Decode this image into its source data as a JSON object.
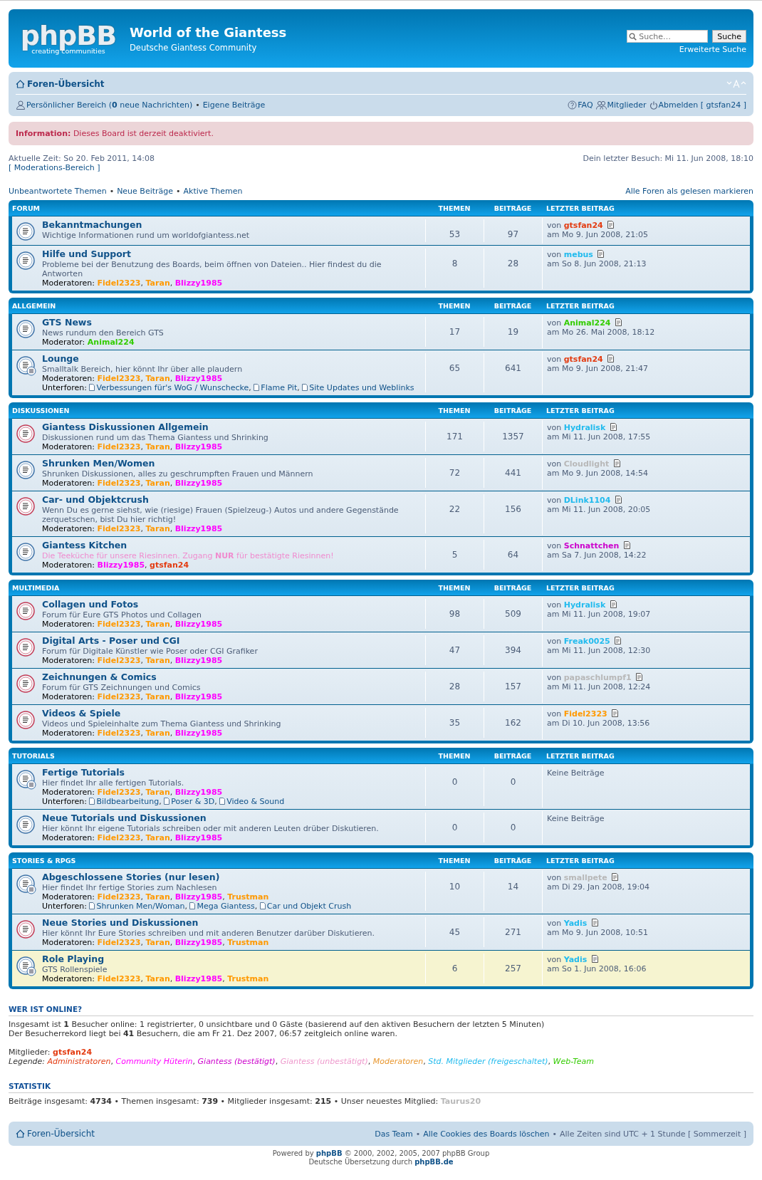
{
  "header": {
    "logo": "phpBB",
    "logo_tagline": "creating communities",
    "site_title": "World of the Giantess",
    "site_subtitle": "Deutsche Giantess Community",
    "search": {
      "placeholder": "Suche…",
      "button": "Suche",
      "advanced": "Erweiterte Suche"
    }
  },
  "navbar": {
    "home": "Foren-Übersicht",
    "pm": "Persönlicher Bereich (**0** neue Nachrichten)",
    "sep": "•",
    "own_posts": "Eigene Beiträge",
    "faq": "FAQ",
    "members": "Mitglieder",
    "logout": "Abmelden [ gtsfan24 ]"
  },
  "info": "**Information:** Dieses Board ist derzeit deaktiviert.",
  "current_time": "Aktuelle Zeit: So 20. Feb 2011, 14:08",
  "moderation_link": "[ Moderations-Bereich ]",
  "last_visit": "Dein letzter Besuch: Mi 11. Jun 2008, 18:10",
  "quick_links": [
    {
      "kind": "link",
      "text": "Unbeantwortete Themen"
    },
    {
      "kind": "sep",
      "text": "•"
    },
    {
      "kind": "link",
      "text": "Neue Beiträge"
    },
    {
      "kind": "sep",
      "text": "•"
    },
    {
      "kind": "link",
      "text": "Aktive Themen"
    }
  ],
  "mark_read": "Alle Foren als gelesen markieren",
  "list_separator": ",",
  "categories": [
    {
      "name": "FORUM",
      "columns": [
        "THEMEN",
        "BEITRÄGE",
        "LETZTER BEITRAG"
      ],
      "forums": [
        {
          "kind": "forum",
          "unread": false,
          "highlighted": false,
          "title": "Bekanntmachungen",
          "description": "Wichtige Informationen rund um worldofgiantess.net",
          "topics": "53",
          "posts": "97",
          "last_post": {
            "by": "von",
            "user": {
              "name": "gtsfan24",
              "color": "#e33c12"
            },
            "date": "am Mo 9. Jun 2008, 21:05"
          }
        },
        {
          "kind": "forum",
          "unread": false,
          "highlighted": false,
          "title": "Hilfe und Support",
          "description": "Probleme bei der Benutzung des Boards, beim öffnen von Dateien.. Hier findest du die Antworten",
          "moderators_label": "Moderatoren:",
          "moderators": [
            {
              "name": "Fidel2323",
              "color": "#ff9900"
            },
            {
              "name": "Taran",
              "color": "#ff9900"
            },
            {
              "name": "Blizzy1985",
              "color": "#ff00ff"
            }
          ],
          "topics": "8",
          "posts": "28",
          "last_post": {
            "by": "von",
            "user": {
              "name": "mebus",
              "color": "#22bbee"
            },
            "date": "am So 8. Jun 2008, 21:13"
          }
        }
      ]
    },
    {
      "name": "ALLGEMEIN",
      "columns": [
        "THEMEN",
        "BEITRÄGE",
        "LETZTER BEITRAG"
      ],
      "forums": [
        {
          "kind": "forum",
          "unread": false,
          "highlighted": false,
          "title": "GTS News",
          "description": "News rundum den Bereich GTS",
          "moderators_label": "Moderator:",
          "moderators": [
            {
              "name": "Animal224",
              "color": "#33cc00"
            }
          ],
          "topics": "17",
          "posts": "19",
          "last_post": {
            "by": "von",
            "user": {
              "name": "Animal224",
              "color": "#33cc00"
            },
            "date": "am Mo 26. Mai 2008, 18:12"
          }
        },
        {
          "kind": "forum_with_subforums",
          "unread": false,
          "highlighted": false,
          "title": "Lounge",
          "description": "Smalltalk Bereich, hier könnt Ihr über alle plaudern",
          "moderators_label": "Moderatoren:",
          "moderators": [
            {
              "name": "Fidel2323",
              "color": "#ff9900"
            },
            {
              "name": "Taran",
              "color": "#ff9900"
            },
            {
              "name": "Blizzy1985",
              "color": "#ff00ff"
            }
          ],
          "subforums_label": "Unterforen:",
          "subforums": [
            "Verbessungen für's WoG / Wunschecke",
            "Flame Pit",
            "Site Updates und Weblinks"
          ],
          "topics": "65",
          "posts": "641",
          "last_post": {
            "by": "von",
            "user": {
              "name": "gtsfan24",
              "color": "#e33c12"
            },
            "date": "am Mo 9. Jun 2008, 21:47"
          }
        }
      ]
    },
    {
      "name": "DISKUSSIONEN",
      "columns": [
        "THEMEN",
        "BEITRÄGE",
        "LETZTER BEITRAG"
      ],
      "forums": [
        {
          "kind": "forum",
          "unread": true,
          "highlighted": false,
          "title": "Giantess Diskussionen Allgemein",
          "description": "Diskussionen rund um das Thema Giantess und Shrinking",
          "moderators_label": "Moderatoren:",
          "moderators": [
            {
              "name": "Fidel2323",
              "color": "#ff9900"
            },
            {
              "name": "Taran",
              "color": "#ff9900"
            },
            {
              "name": "Blizzy1985",
              "color": "#ff00ff"
            }
          ],
          "topics": "171",
          "posts": "1357",
          "last_post": {
            "by": "von",
            "user": {
              "name": "Hydralisk",
              "color": "#22bbee"
            },
            "date": "am Mi 11. Jun 2008, 17:55"
          }
        },
        {
          "kind": "forum",
          "unread": false,
          "highlighted": false,
          "title": "Shrunken Men/Women",
          "description": "Shrunken Diskussionen, alles zu geschrumpften Frauen und Männern",
          "moderators_label": "Moderatoren:",
          "moderators": [
            {
              "name": "Fidel2323",
              "color": "#ff9900"
            },
            {
              "name": "Taran",
              "color": "#ff9900"
            },
            {
              "name": "Blizzy1985",
              "color": "#ff00ff"
            }
          ],
          "topics": "72",
          "posts": "441",
          "last_post": {
            "by": "von",
            "user": {
              "name": "Cloudlight",
              "color": "#b8b8b8"
            },
            "date": "am Mo 9. Jun 2008, 14:54"
          }
        },
        {
          "kind": "forum",
          "unread": true,
          "highlighted": false,
          "title": "Car- und Objektcrush",
          "description": "Wenn Du es gerne siehst, wie (riesige) Frauen (Spielzeug-) Autos und andere Gegenstände zerquetschen, bist Du hier richtig!",
          "moderators_label": "Moderatoren:",
          "moderators": [
            {
              "name": "Fidel2323",
              "color": "#ff9900"
            },
            {
              "name": "Taran",
              "color": "#ff9900"
            },
            {
              "name": "Blizzy1985",
              "color": "#ff00ff"
            }
          ],
          "topics": "22",
          "posts": "156",
          "last_post": {
            "by": "von",
            "user": {
              "name": "DLink1104",
              "color": "#22bbee"
            },
            "date": "am Mi 11. Jun 2008, 20:05"
          }
        },
        {
          "kind": "forum",
          "unread": false,
          "highlighted": false,
          "title": "Giantess Kitchen",
          "description": "Die Teeküche für unsere Riesinnen. Zugang **NUR** für bestätigte Riesinnen!",
          "color": "#f08ccf",
          "moderators_label": "Moderatoren:",
          "moderators": [
            {
              "name": "Blizzy1985",
              "color": "#ff00ff"
            },
            {
              "name": "gtsfan24",
              "color": "#e33c12"
            }
          ],
          "topics": "5",
          "posts": "64",
          "last_post": {
            "by": "von",
            "user": {
              "name": "Schnattchen",
              "color": "#cc00cc"
            },
            "date": "am Sa 7. Jun 2008, 14:22"
          }
        }
      ]
    },
    {
      "name": "MULTIMEDIA",
      "columns": [
        "THEMEN",
        "BEITRÄGE",
        "LETZTER BEITRAG"
      ],
      "forums": [
        {
          "kind": "forum",
          "unread": true,
          "highlighted": false,
          "title": "Collagen und Fotos",
          "description": "Forum für Eure GTS Photos und Collagen",
          "moderators_label": "Moderatoren:",
          "moderators": [
            {
              "name": "Fidel2323",
              "color": "#ff9900"
            },
            {
              "name": "Taran",
              "color": "#ff9900"
            },
            {
              "name": "Blizzy1985",
              "color": "#ff00ff"
            }
          ],
          "topics": "98",
          "posts": "509",
          "last_post": {
            "by": "von",
            "user": {
              "name": "Hydralisk",
              "color": "#22bbee"
            },
            "date": "am Mi 11. Jun 2008, 19:07"
          }
        },
        {
          "kind": "forum",
          "unread": true,
          "highlighted": false,
          "title": "Digital Arts - Poser und CGI",
          "description": "Forum für Digitale Künstler wie Poser oder CGI Grafiker",
          "moderators_label": "Moderatoren:",
          "moderators": [
            {
              "name": "Fidel2323",
              "color": "#ff9900"
            },
            {
              "name": "Taran",
              "color": "#ff9900"
            },
            {
              "name": "Blizzy1985",
              "color": "#ff00ff"
            }
          ],
          "topics": "47",
          "posts": "394",
          "last_post": {
            "by": "von",
            "user": {
              "name": "Freak0025",
              "color": "#22bbee"
            },
            "date": "am Mi 11. Jun 2008, 12:30"
          }
        },
        {
          "kind": "forum",
          "unread": true,
          "highlighted": false,
          "title": "Zeichnungen & Comics",
          "description": "Forum für GTS Zeichnungen und Comics",
          "moderators_label": "Moderatoren:",
          "moderators": [
            {
              "name": "Fidel2323",
              "color": "#ff9900"
            },
            {
              "name": "Taran",
              "color": "#ff9900"
            },
            {
              "name": "Blizzy1985",
              "color": "#ff00ff"
            }
          ],
          "topics": "28",
          "posts": "157",
          "last_post": {
            "by": "von",
            "user": {
              "name": "papaschlumpf1",
              "color": "#b8b8b8"
            },
            "date": "am Mi 11. Jun 2008, 12:24"
          }
        },
        {
          "kind": "forum",
          "unread": true,
          "highlighted": false,
          "title": "Videos & Spiele",
          "description": "Videos und Spieleinhalte zum Thema Giantess und Shrinking",
          "moderators_label": "Moderatoren:",
          "moderators": [
            {
              "name": "Fidel2323",
              "color": "#ff9900"
            },
            {
              "name": "Taran",
              "color": "#ff9900"
            },
            {
              "name": "Blizzy1985",
              "color": "#ff00ff"
            }
          ],
          "topics": "35",
          "posts": "162",
          "last_post": {
            "by": "von",
            "user": {
              "name": "Fidel2323",
              "color": "#ff9900"
            },
            "date": "am Di 10. Jun 2008, 13:56"
          }
        }
      ]
    },
    {
      "name": "TUTORIALS",
      "columns": [
        "THEMEN",
        "BEITRÄGE",
        "LETZTER BEITRAG"
      ],
      "forums": [
        {
          "kind": "forum_with_subforums",
          "unread": false,
          "highlighted": false,
          "title": "Fertige Tutorials",
          "description": "Hier findet Ihr alle fertigen Tutorials.",
          "moderators_label": "Moderatoren:",
          "moderators": [
            {
              "name": "Fidel2323",
              "color": "#ff9900"
            },
            {
              "name": "Taran",
              "color": "#ff9900"
            },
            {
              "name": "Blizzy1985",
              "color": "#ff00ff"
            }
          ],
          "subforums_label": "Unterforen:",
          "subforums": [
            "Bildbearbeitung",
            "Poser & 3D",
            "Video & Sound"
          ],
          "topics": "0",
          "posts": "0",
          "no_posts": "Keine Beiträge"
        },
        {
          "kind": "forum",
          "unread": false,
          "highlighted": false,
          "title": "Neue Tutorials und Diskussionen",
          "description": "Hier könnt Ihr eigene Tutorials schreiben oder mit anderen Leuten drüber Diskutieren.",
          "moderators_label": "Moderatoren:",
          "moderators": [
            {
              "name": "Fidel2323",
              "color": "#ff9900"
            },
            {
              "name": "Taran",
              "color": "#ff9900"
            },
            {
              "name": "Blizzy1985",
              "color": "#ff00ff"
            }
          ],
          "topics": "0",
          "posts": "0",
          "no_posts": "Keine Beiträge"
        }
      ]
    },
    {
      "name": "STORIES & RPGS",
      "columns": [
        "THEMEN",
        "BEITRÄGE",
        "LETZTER BEITRAG"
      ],
      "forums": [
        {
          "kind": "forum_with_subforums",
          "unread": false,
          "highlighted": false,
          "title": "Abgeschlossene Stories (nur lesen)",
          "description": "Hier findet Ihr fertige Stories zum Nachlesen",
          "moderators_label": "Moderatoren:",
          "moderators": [
            {
              "name": "Fidel2323",
              "color": "#ff9900"
            },
            {
              "name": "Taran",
              "color": "#ff9900"
            },
            {
              "name": "Blizzy1985",
              "color": "#ff00ff"
            },
            {
              "name": "Trustman",
              "color": "#ff9900"
            }
          ],
          "subforums_label": "Unterforen:",
          "subforums": [
            "Shrunken Men/Woman",
            "Mega Giantess",
            "Car und Objekt Crush"
          ],
          "topics": "10",
          "posts": "14",
          "last_post": {
            "by": "von",
            "user": {
              "name": "smallpete",
              "color": "#b8b8b8"
            },
            "date": "am Di 29. Jan 2008, 19:04"
          }
        },
        {
          "kind": "forum",
          "unread": true,
          "highlighted": false,
          "title": "Neue Stories und Diskussionen",
          "description": "Hier könnt Ihr Eure Stories schreiben und mit anderen Benutzer darüber Diskutieren.",
          "moderators_label": "Moderatoren:",
          "moderators": [
            {
              "name": "Fidel2323",
              "color": "#ff9900"
            },
            {
              "name": "Taran",
              "color": "#ff9900"
            },
            {
              "name": "Blizzy1985",
              "color": "#ff00ff"
            },
            {
              "name": "Trustman",
              "color": "#ff9900"
            }
          ],
          "topics": "45",
          "posts": "271",
          "last_post": {
            "by": "von",
            "user": {
              "name": "Yadis",
              "color": "#22bbee"
            },
            "date": "am Mo 9. Jun 2008, 10:51"
          }
        },
        {
          "kind": "forum_with_subforums",
          "unread": false,
          "highlighted": true,
          "title": "Role Playing",
          "description": "GTS Rollenspiele",
          "moderators_label": "Moderatoren:",
          "moderators": [
            {
              "name": "Fidel2323",
              "color": "#ff9900"
            },
            {
              "name": "Taran",
              "color": "#ff9900"
            },
            {
              "name": "Blizzy1985",
              "color": "#ff00ff"
            },
            {
              "name": "Trustman",
              "color": "#ff9900"
            }
          ],
          "topics": "6",
          "posts": "257",
          "last_post": {
            "by": "von",
            "user": {
              "name": "Yadis",
              "color": "#22bbee"
            },
            "date": "am So 1. Jun 2008, 16:06"
          }
        }
      ]
    }
  ],
  "online": {
    "heading": "WER IST ONLINE?",
    "lines": [
      "Insgesamt ist **1** Besucher online: 1 registrierter, 0 unsichtbare und 0 Gäste (basierend auf den aktiven Besuchern der letzten 5 Minuten)",
      "Der Besucherrekord liegt bei **41** Besuchern, die am Fr 21. Dez 2007, 06:57 zeitgleich online waren."
    ],
    "members_label": "Mitglieder:",
    "members": [
      {
        "name": "gtsfan24",
        "color": "#e33c12"
      }
    ],
    "legend_label": "Legende:",
    "legend": [
      {
        "name": "Administratoren",
        "color": "#e33c12"
      },
      {
        "name": "Community Hüterin",
        "color": "#ff00ff"
      },
      {
        "name": "Giantess (bestätigt)",
        "color": "#cc00cc"
      },
      {
        "name": "Giantess (unbestätigt)",
        "color": "#ee99cc"
      },
      {
        "name": "Moderatoren",
        "color": "#e8962e"
      },
      {
        "name": "Std. Mitglieder (freigeschaltet)",
        "color": "#22bbee"
      },
      {
        "name": "Web-Team",
        "color": "#33cc00"
      }
    ]
  },
  "statistics": {
    "heading": "STATISTIK",
    "text": "Beiträge insgesamt: **4734** • Themen insgesamt: **739** • Mitglieder insgesamt: **215** • Unser neuestes Mitglied:",
    "newest_member": {
      "name": "Taurus20",
      "color": "#b8b8b8"
    }
  },
  "footer": {
    "home": "Foren-Übersicht",
    "links": [
      {
        "kind": "link",
        "text": "Das Team"
      },
      {
        "kind": "sep",
        "text": "•"
      },
      {
        "kind": "link",
        "text": "Alle Cookies des Boards löschen"
      },
      {
        "kind": "sep",
        "text": "•"
      },
      {
        "kind": "text",
        "text": "Alle Zeiten sind UTC + 1 Stunde [ Sommerzeit ]"
      }
    ]
  },
  "credits": [
    {
      "before": "Powered by ",
      "link": "phpBB",
      "after": " © 2000, 2002, 2005, 2007 phpBB Group"
    },
    {
      "before": "Deutsche Übersetzung durch ",
      "link": "phpBB.de"
    }
  ]
}
